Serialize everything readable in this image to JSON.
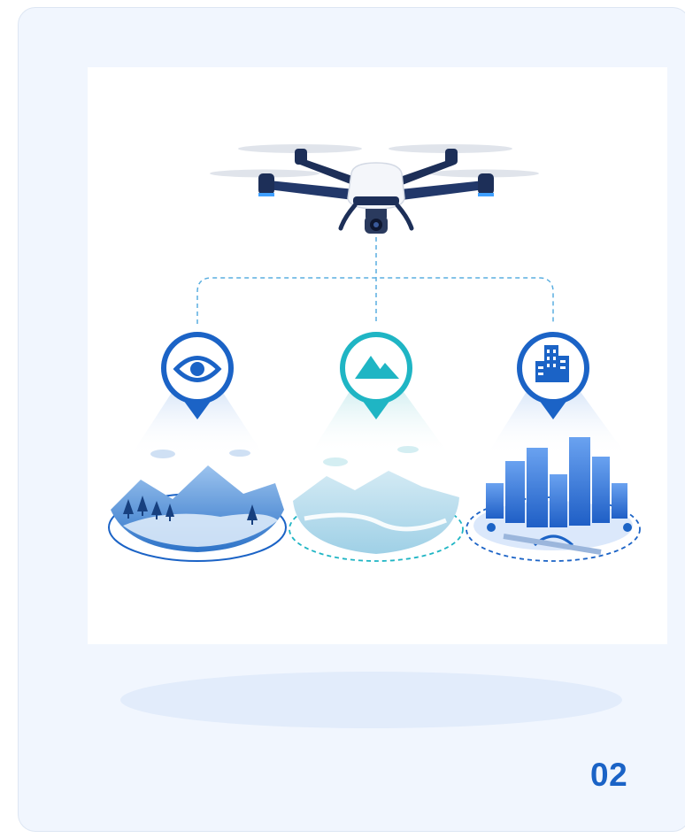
{
  "card": {
    "number": "02"
  },
  "illustration": {
    "icons": [
      "drone-icon",
      "eye-icon",
      "mountain-icon",
      "city-icon"
    ],
    "colors": {
      "accent": "#1b63c6",
      "teal": "#1fb5c4",
      "background": "#f1f6fe"
    }
  }
}
